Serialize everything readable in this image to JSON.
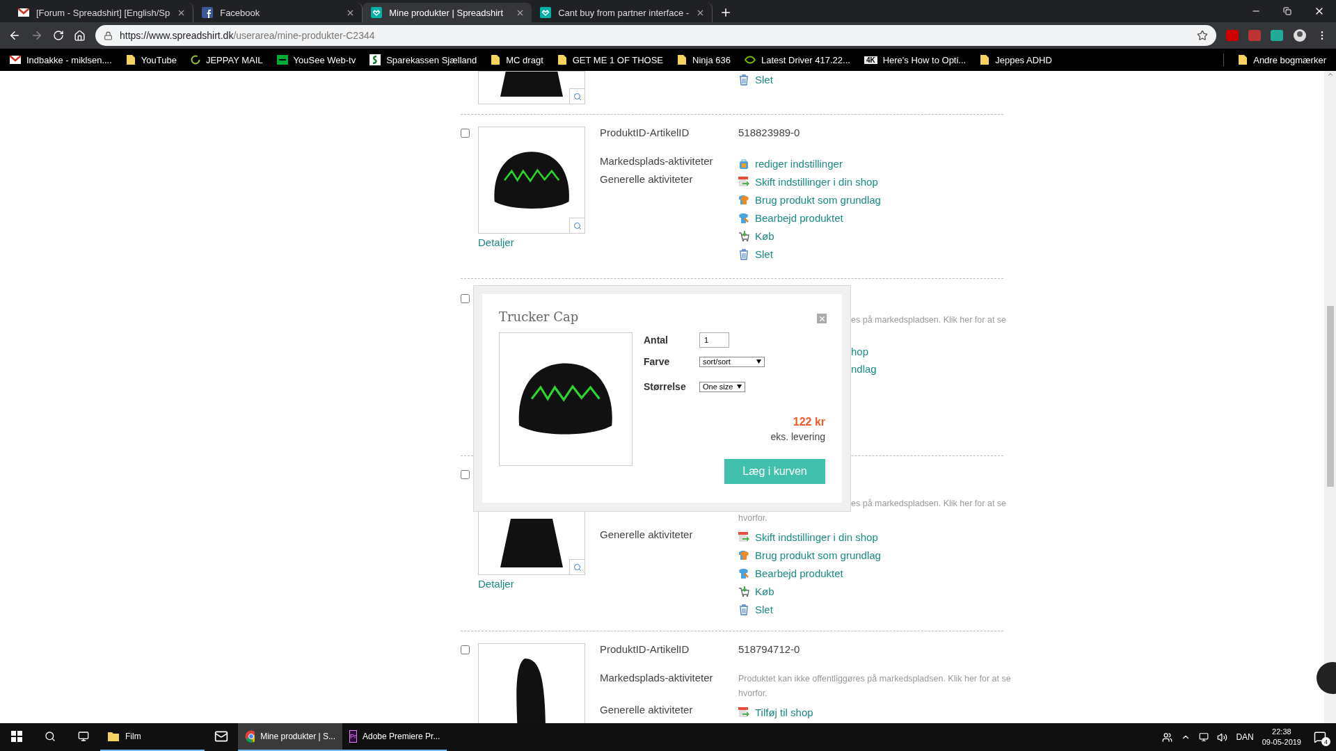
{
  "tabs": [
    {
      "kind": "gmail",
      "label": "[Forum - Spreadshirt] [English/Sp",
      "selected": false
    },
    {
      "kind": "facebook",
      "label": "Facebook",
      "selected": false
    },
    {
      "kind": "spreadshirt",
      "label": "Mine produkter | Spreadshirt",
      "selected": true
    },
    {
      "kind": "spreadshirt",
      "label": "Cant buy from partner interface -",
      "selected": false
    }
  ],
  "address": {
    "host": "https://www.spreadshirt.dk",
    "path": "/userarea/mine-produkter-C2344"
  },
  "bookmarks": [
    {
      "kind": "gmail",
      "label": "Indbakke - miklsen...."
    },
    {
      "kind": "folder",
      "label": "YouTube"
    },
    {
      "kind": "ring",
      "label": "JEPPAY MAIL"
    },
    {
      "kind": "tv",
      "label": "YouSee Web-tv"
    },
    {
      "kind": "bank",
      "label": "Sparekassen Sjælland"
    },
    {
      "kind": "folder",
      "label": "MC dragt"
    },
    {
      "kind": "folder",
      "label": "GET ME 1 OF THOSE"
    },
    {
      "kind": "folder",
      "label": "Ninja 636"
    },
    {
      "kind": "nvidia",
      "label": "Latest Driver 417.22..."
    },
    {
      "kind": "badge",
      "label": "Here's How to Opti...",
      "badge": "4K"
    },
    {
      "kind": "folder",
      "label": "Jeppes ADHD"
    }
  ],
  "other_bookmarks": "Andre bogmærker",
  "products": [
    {
      "kind": "tail",
      "links": [
        {
          "kind": "delete",
          "label": "Slet"
        }
      ]
    },
    {
      "kind": "full",
      "checked": false,
      "id_label": "ProduktID-ArtikelID",
      "id": "518823989-0",
      "market_label": "Markedsplads-aktiviteter",
      "market_links": [
        {
          "kind": "market",
          "label": "rediger indstillinger"
        }
      ],
      "general_label": "Generelle aktiviteter",
      "links": [
        {
          "kind": "shop",
          "label": "Skift indstillinger i din shop"
        },
        {
          "kind": "base",
          "label": "Brug produkt som grundlag"
        },
        {
          "kind": "edit",
          "label": "Bearbejd produktet"
        },
        {
          "kind": "buy",
          "label": "Køb"
        },
        {
          "kind": "delete",
          "label": "Slet"
        }
      ],
      "details": "Detaljer"
    },
    {
      "kind": "covered",
      "checked": false,
      "message_fragment": "es på markedspladsen. Klik her for at se",
      "links": [
        {
          "label": "hop"
        },
        {
          "label": "ndlag"
        }
      ]
    },
    {
      "kind": "full",
      "checked": false,
      "message_fragment": "es på markedspladsen. Klik her for at se",
      "message": [
        "hvorfor."
      ],
      "general_label": "Generelle aktiviteter",
      "links": [
        {
          "kind": "shop",
          "label": "Skift indstillinger i din shop"
        },
        {
          "kind": "base",
          "label": "Brug produkt som grundlag"
        },
        {
          "kind": "edit",
          "label": "Bearbejd produktet"
        },
        {
          "kind": "buy",
          "label": "Køb"
        },
        {
          "kind": "delete",
          "label": "Slet"
        }
      ],
      "details": "Detaljer"
    },
    {
      "kind": "full",
      "checked": false,
      "id_label": "ProduktID-ArtikelID",
      "id": "518794712-0",
      "market_label": "Markedsplads-aktiviteter",
      "message": [
        "Produktet kan ikke offentliggøres på markedspladsen. Klik her for at se",
        "hvorfor."
      ],
      "general_label": "Generelle aktiviteter",
      "links": [
        {
          "kind": "shop",
          "label": "Tilføj til shop"
        }
      ]
    }
  ],
  "dialog": {
    "title": "Trucker Cap",
    "fields": [
      {
        "kind": "input",
        "label": "Antal",
        "value": "1"
      },
      {
        "kind": "select",
        "label": "Farve",
        "value": "sort/sort"
      },
      {
        "kind": "select",
        "label": "Størrelse",
        "value": "One size"
      }
    ],
    "price": "122 kr",
    "price_note": "eks. levering",
    "button": "Læg i kurven"
  },
  "taskbar": {
    "apps": [
      {
        "kind": "folder",
        "label": "Film",
        "selected": false,
        "running": true
      },
      {
        "kind": "mail",
        "selected": false,
        "running": false
      },
      {
        "kind": "chrome",
        "label": "Mine produkter | S...",
        "selected": true,
        "running": true
      },
      {
        "kind": "premiere",
        "icon_text": "Pr",
        "label": "Adobe Premiere Pr...",
        "selected": false,
        "running": true
      }
    ],
    "language": "DAN",
    "time": "22:38",
    "date": "09-05-2019",
    "notifications": "4"
  }
}
